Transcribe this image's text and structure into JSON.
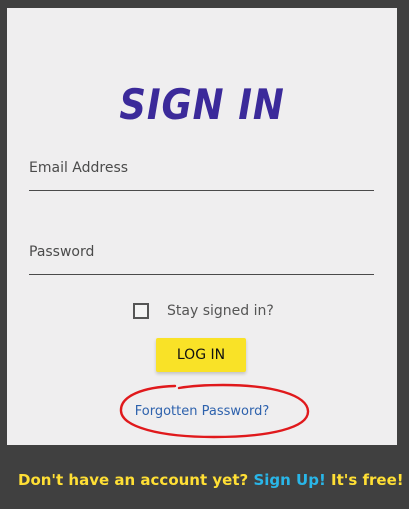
{
  "card": {
    "title": "SIGN IN",
    "email_label": "Email Address",
    "password_label": "Password",
    "remember_label": "Stay signed in?",
    "login_label": "LOG IN",
    "forgot_label": "Forgotten Password?"
  },
  "footer": {
    "prefix": "Don't have an account yet?",
    "signup_label": "Sign Up!",
    "suffix": "It's free!"
  },
  "colors": {
    "page_background": "#404040",
    "card_background": "#efeeef",
    "title_color": "#3b2a9a",
    "button_color": "#f9e227",
    "link_color": "#2e62ad",
    "footer_text": "#ffdf35",
    "signup_link": "#29b6e8",
    "annotation_circle": "#e0191c"
  },
  "icons": {
    "checkbox": "checkbox-unchecked"
  }
}
